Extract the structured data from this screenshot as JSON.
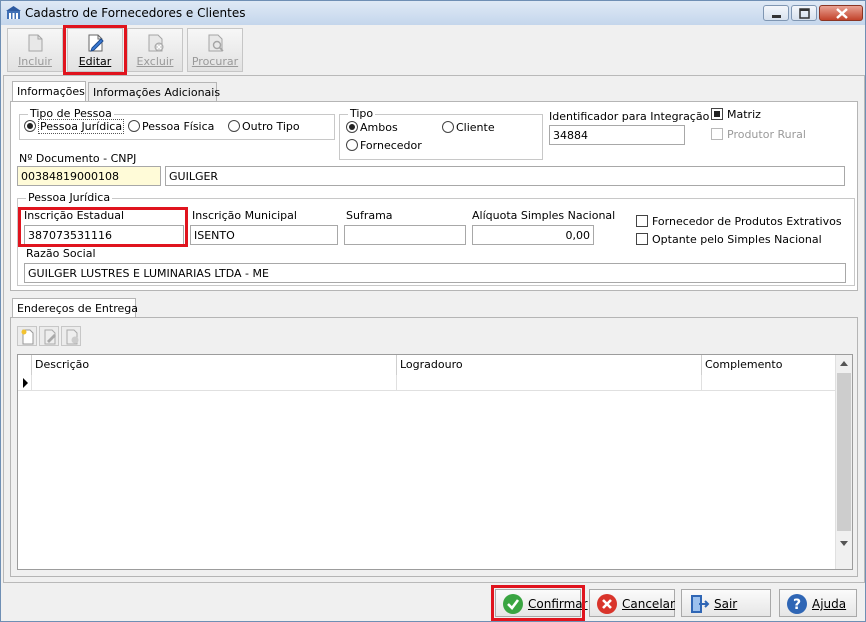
{
  "window": {
    "title": "Cadastro de Fornecedores e Clientes"
  },
  "toolbar": {
    "incluir": "Incluir",
    "editar": "Editar",
    "excluir": "Excluir",
    "procurar": "Procurar"
  },
  "tabs": {
    "informacoes": "Informações",
    "informacoes_adicionais": "Informações Adicionais"
  },
  "tipo_pessoa": {
    "title": "Tipo de Pessoa",
    "juridica": "Pessoa Jurídica",
    "fisica": "Pessoa Física",
    "outro": "Outro Tipo"
  },
  "tipo": {
    "title": "Tipo",
    "ambos": "Ambos",
    "cliente": "Cliente",
    "fornecedor": "Fornecedor"
  },
  "identificador": {
    "label": "Identificador para Integração",
    "value": "34884"
  },
  "matriz": {
    "label": "Matriz",
    "checked": true
  },
  "produtor_rural": {
    "label": "Produtor Rural",
    "checked": false
  },
  "documento": {
    "label": "Nº Documento - CNPJ",
    "value": "00384819000108",
    "name_value": "GUILGER"
  },
  "pessoa_juridica": {
    "title": "Pessoa Jurídica",
    "inscricao_estadual_label": "Inscrição Estadual",
    "inscricao_estadual_value": "387073531116",
    "inscricao_municipal_label": "Inscrição Municipal",
    "inscricao_municipal_value": "ISENTO",
    "suframa_label": "Suframa",
    "suframa_value": "",
    "aliquota_label": "Alíquota Simples Nacional",
    "aliquota_value": "0,00",
    "fornecedor_extrativos": "Fornecedor de Produtos Extrativos",
    "optante_simples": "Optante pelo Simples Nacional",
    "razao_social_label": "Razão Social",
    "razao_social_value": "GUILGER LUSTRES E LUMINARIAS LTDA - ME"
  },
  "enderecos": {
    "tab": "Endereços de Entrega",
    "columns": [
      "Descrição",
      "Logradouro",
      "Complemento"
    ]
  },
  "buttons": {
    "confirmar": "Confirmar",
    "cancelar": "Cancelar",
    "sair": "Sair",
    "ajuda": "Ajuda"
  },
  "colors": {
    "highlight": "#e0141e",
    "required_field": "#fffbd8",
    "titlebar": "#c4d6ec"
  }
}
